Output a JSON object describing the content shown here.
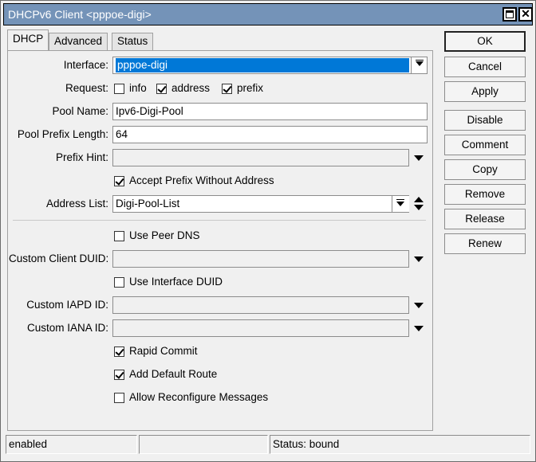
{
  "window": {
    "title": "DHCPv6 Client <pppoe-digi>",
    "close_glyph": "✕"
  },
  "tabs": [
    {
      "label": "DHCP"
    },
    {
      "label": "Advanced"
    },
    {
      "label": "Status"
    }
  ],
  "form": {
    "interface": {
      "label": "Interface:",
      "value": "pppoe-digi"
    },
    "request": {
      "label": "Request:",
      "options": [
        {
          "label": "info",
          "checked": false
        },
        {
          "label": "address",
          "checked": true
        },
        {
          "label": "prefix",
          "checked": true
        }
      ]
    },
    "pool_name": {
      "label": "Pool Name:",
      "value": "Ipv6-Digi-Pool"
    },
    "pool_prefix_length": {
      "label": "Pool Prefix Length:",
      "value": "64"
    },
    "prefix_hint": {
      "label": "Prefix Hint:",
      "value": ""
    },
    "accept_prefix_without_address": {
      "label": "Accept Prefix Without Address",
      "checked": true
    },
    "address_list": {
      "label": "Address List:",
      "value": "Digi-Pool-List"
    },
    "use_peer_dns": {
      "label": "Use Peer DNS",
      "checked": false
    },
    "custom_client_duid": {
      "label": "Custom Client DUID:",
      "value": ""
    },
    "use_interface_duid": {
      "label": "Use Interface DUID",
      "checked": false
    },
    "custom_iapd_id": {
      "label": "Custom IAPD ID:",
      "value": ""
    },
    "custom_iana_id": {
      "label": "Custom IANA ID:",
      "value": ""
    },
    "rapid_commit": {
      "label": "Rapid Commit",
      "checked": true
    },
    "add_default_route": {
      "label": "Add Default Route",
      "checked": true
    },
    "allow_reconfigure_messages": {
      "label": "Allow Reconfigure Messages",
      "checked": false
    }
  },
  "buttons": {
    "ok": "OK",
    "cancel": "Cancel",
    "apply": "Apply",
    "disable": "Disable",
    "comment": "Comment",
    "copy": "Copy",
    "remove": "Remove",
    "release": "Release",
    "renew": "Renew"
  },
  "statusbar": {
    "state": "enabled",
    "middle": "",
    "status": "Status: bound"
  }
}
